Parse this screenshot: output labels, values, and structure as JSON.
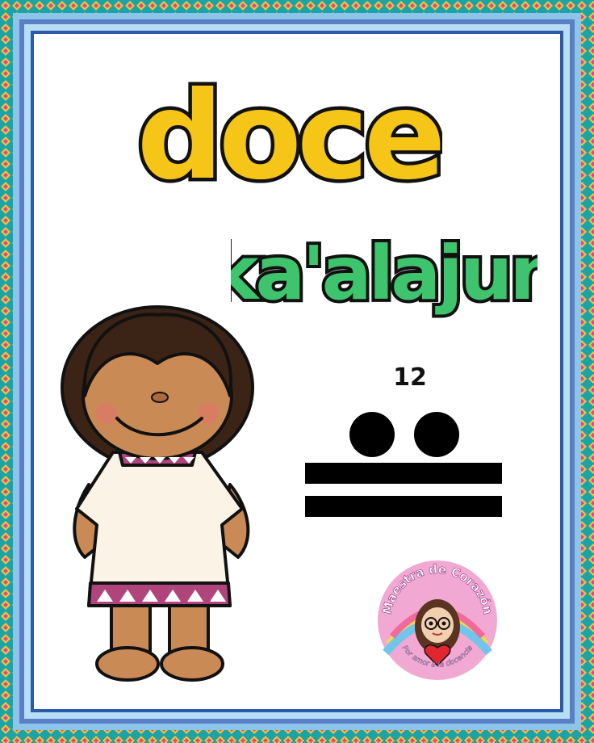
{
  "card": {
    "word_spanish": "doce",
    "word_maya": "ka'alajun",
    "number": "12",
    "maya_numeral": {
      "dots": 2,
      "bars": 2
    }
  },
  "logo": {
    "title": "Maestra de Corazón",
    "tagline": "Por amor a la docencia"
  },
  "colors": {
    "yellow": "#f5c518",
    "green": "#3ec46d",
    "border_teal": "#1aa3a8",
    "border_blue": "#a9d3ef",
    "skin": "#c98a55",
    "hair": "#3b2416",
    "dress": "#faf3e6",
    "dress_trim": "#b0457d"
  }
}
